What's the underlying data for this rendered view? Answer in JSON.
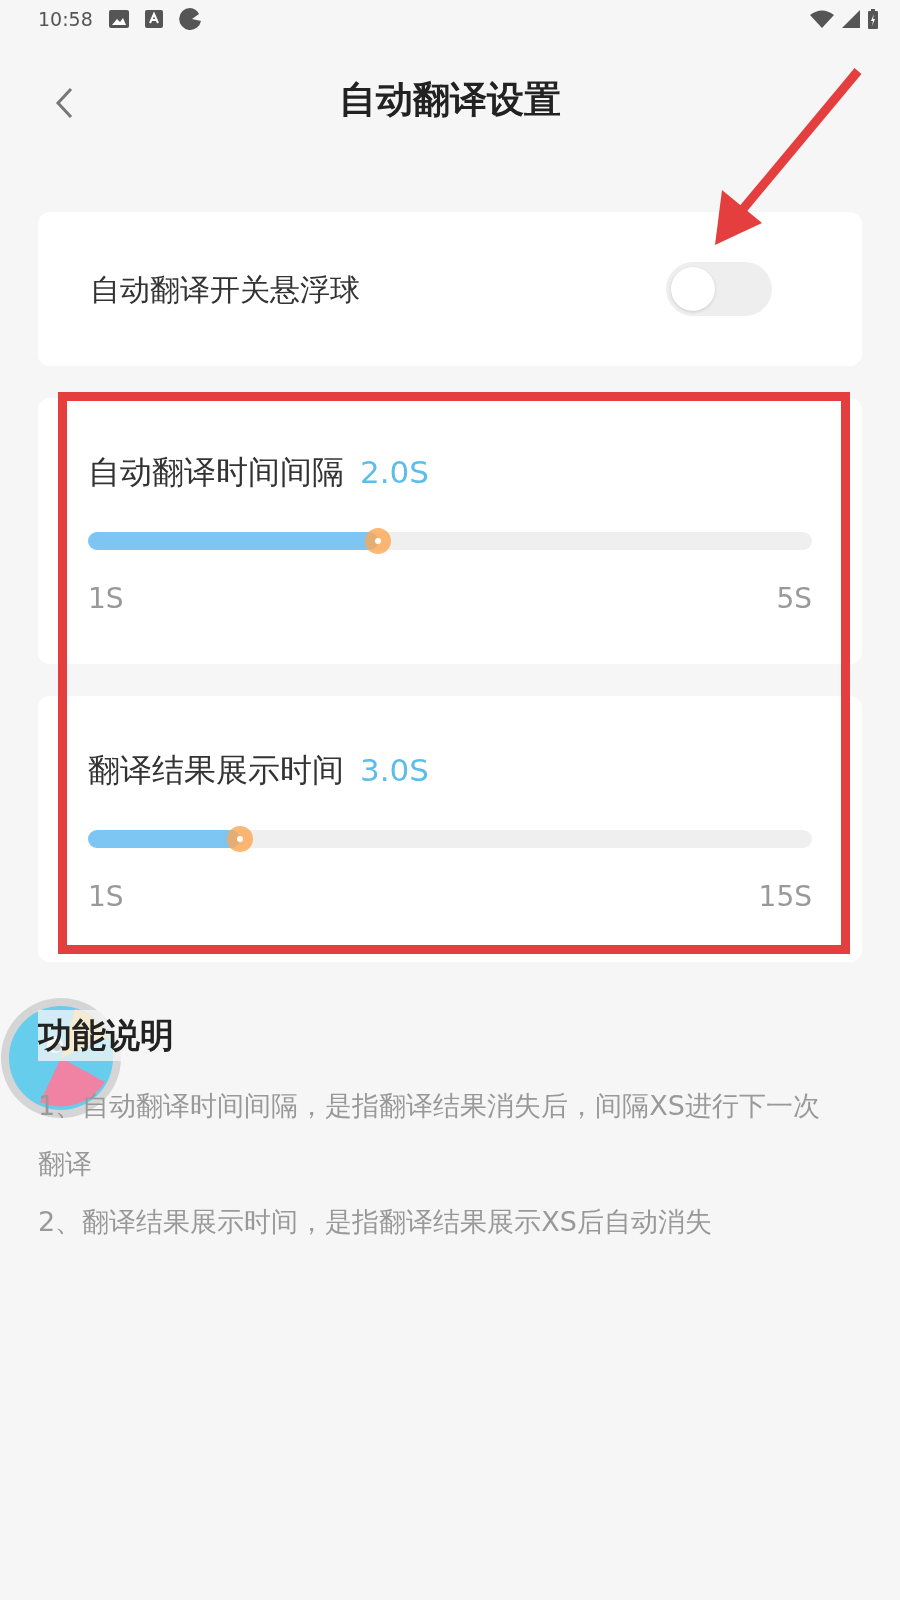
{
  "status_bar": {
    "time": "10:58"
  },
  "header": {
    "title": "自动翻译设置"
  },
  "toggle_card": {
    "label": "自动翻译开关悬浮球",
    "on": false
  },
  "sliders": [
    {
      "label": "自动翻译时间间隔",
      "value": "2.0S",
      "level": 0.4,
      "min": "1S",
      "max": "5S"
    },
    {
      "label": "翻译结果展示时间",
      "value": "3.0S",
      "level": 0.21,
      "min": "1S",
      "max": "15S"
    }
  ],
  "description": {
    "title": "功能说明",
    "lines": [
      "1、自动翻译时间间隔，是指翻译结果消失后，间隔XS进行下一次翻译",
      "2、翻译结果展示时间，是指翻译结果展示XS后自动消失"
    ]
  },
  "annotations": {
    "arrow": true,
    "highlight_box": true
  }
}
